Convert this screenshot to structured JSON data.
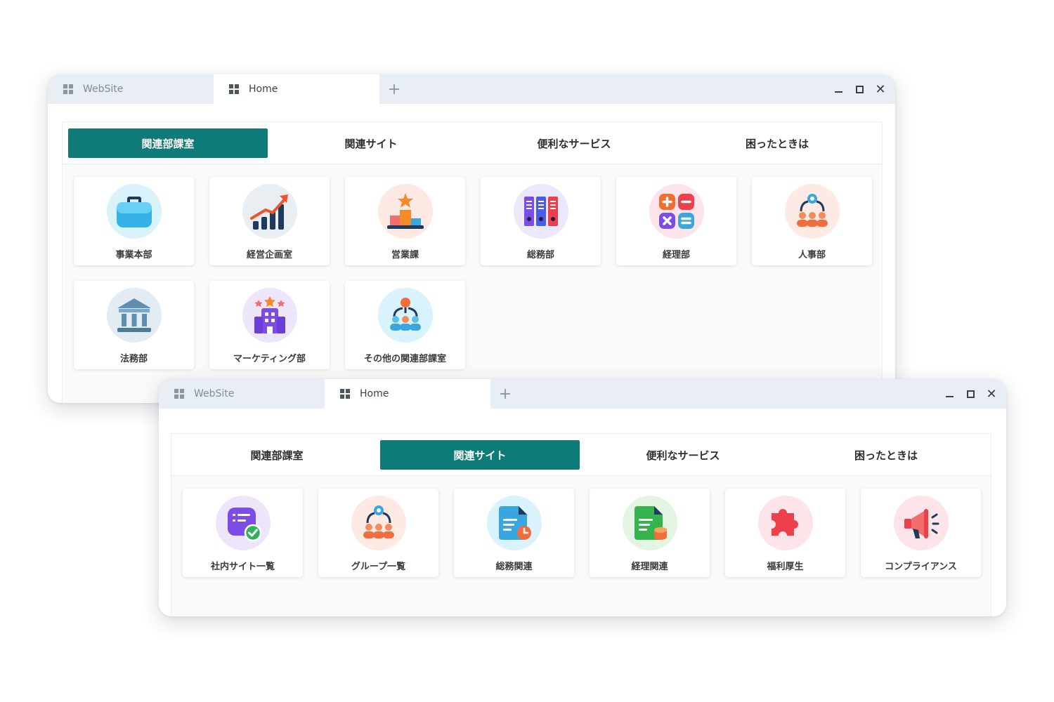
{
  "windows": [
    {
      "tabs": {
        "inactive": "WebSite",
        "active": "Home",
        "add": "+"
      },
      "controls": {
        "minimize": "minimize-icon",
        "maximize": "maximize-icon",
        "close": "close-icon"
      },
      "nav": [
        "関連部課室",
        "関連サイト",
        "便利なサービス",
        "困ったときは"
      ],
      "active_nav": 0,
      "cards": [
        {
          "label": "事業本部",
          "icon": "briefcase-icon",
          "bg": "#d8f3fb"
        },
        {
          "label": "経営企画室",
          "icon": "growth-chart-icon",
          "bg": "#e9eef3"
        },
        {
          "label": "営業課",
          "icon": "podium-icon",
          "bg": "#fde9e4"
        },
        {
          "label": "総務部",
          "icon": "binders-icon",
          "bg": "#ece8fb"
        },
        {
          "label": "経理部",
          "icon": "calculator-icon",
          "bg": "#fde4ea"
        },
        {
          "label": "人事部",
          "icon": "team-network-icon",
          "bg": "#fdeae4"
        },
        {
          "label": "法務部",
          "icon": "courthouse-icon",
          "bg": "#e3ecf2"
        },
        {
          "label": "マーケティング部",
          "icon": "building-icon",
          "bg": "#ede6fb"
        },
        {
          "label": "その他の関連部課室",
          "icon": "people-network-icon",
          "bg": "#d8f3fb"
        }
      ]
    },
    {
      "tabs": {
        "inactive": "WebSite",
        "active": "Home",
        "add": "+"
      },
      "controls": {
        "minimize": "minimize-icon",
        "maximize": "maximize-icon",
        "close": "close-icon"
      },
      "nav": [
        "関連部課室",
        "関連サイト",
        "便利なサービス",
        "困ったときは"
      ],
      "active_nav": 1,
      "cards": [
        {
          "label": "社内サイト一覧",
          "icon": "site-list-icon",
          "bg": "#ede6fb"
        },
        {
          "label": "グループ一覧",
          "icon": "group-icon",
          "bg": "#fdeae4"
        },
        {
          "label": "総務関連",
          "icon": "document-clock-icon",
          "bg": "#d8f3fb"
        },
        {
          "label": "経理関連",
          "icon": "document-coins-icon",
          "bg": "#e3f4e3"
        },
        {
          "label": "福利厚生",
          "icon": "puzzle-icon",
          "bg": "#fde4e8"
        },
        {
          "label": "コンプライアンス",
          "icon": "megaphone-icon",
          "bg": "#fde4e8"
        }
      ]
    }
  ],
  "colors": {
    "accent": "#0f7b78",
    "titlebar": "#e8eef4"
  }
}
